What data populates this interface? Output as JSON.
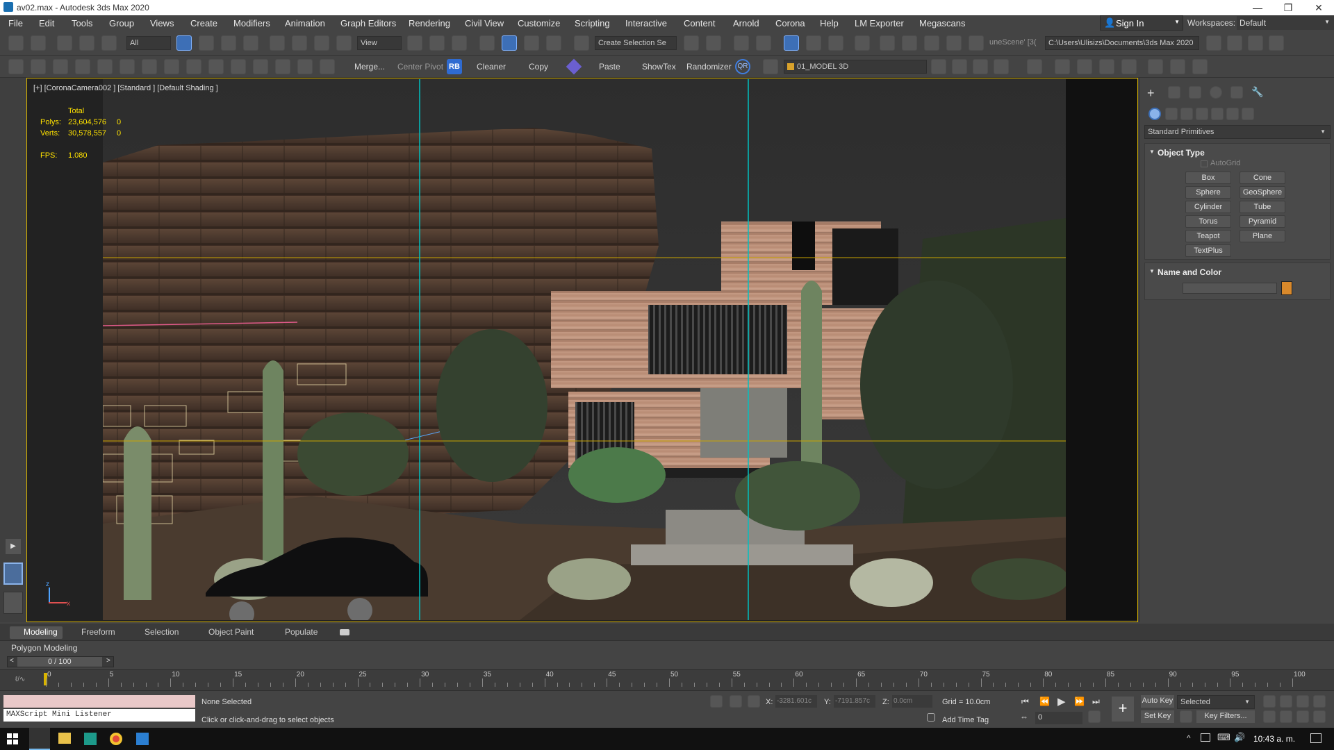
{
  "window": {
    "title": "av02.max - Autodesk 3ds Max 2020",
    "min": "—",
    "restore": "❐",
    "close": "✕"
  },
  "menu": [
    "File",
    "Edit",
    "Tools",
    "Group",
    "Views",
    "Create",
    "Modifiers",
    "Animation",
    "Graph Editors",
    "Rendering",
    "Civil View",
    "Customize",
    "Scripting",
    "Interactive",
    "Content",
    "Arnold",
    "Corona",
    "Help",
    "LM Exporter",
    "Megascans"
  ],
  "account": {
    "sign_in": "Sign In",
    "workspaces_label": "Workspaces:",
    "workspace": "Default"
  },
  "toolbar1": {
    "filter": "All",
    "ref_coord": "View",
    "selection_set": "Create Selection Se",
    "scene_name": "uneScene' [3(",
    "project_path": "C:\\Users\\Ulisizs\\Documents\\3ds Max 2020"
  },
  "toolbar2": {
    "merge": "Merge...",
    "center_pivot": "Center Pivot",
    "rb": "RB",
    "cleaner": "Cleaner",
    "copy": "Copy",
    "paste": "Paste",
    "showtex": "ShowTex",
    "randomizer": "Randomizer",
    "qr": "QR",
    "layer": "01_MODEL 3D"
  },
  "viewport": {
    "label": "[+] [CoronaCamera002 ] [Standard ] [Default Shading ]",
    "stats": {
      "header": "Total",
      "polys_label": "Polys:",
      "polys": "23,604,576",
      "polys_sel": "0",
      "verts_label": "Verts:",
      "verts": "30,578,557",
      "verts_sel": "0",
      "fps_label": "FPS:",
      "fps": "1.080"
    },
    "axis_z": "z",
    "axis_x": "x"
  },
  "command_panel": {
    "category": "Standard Primitives",
    "object_type_title": "Object Type",
    "autogrid": "AutoGrid",
    "buttons": [
      "Box",
      "Cone",
      "Sphere",
      "GeoSphere",
      "Cylinder",
      "Tube",
      "Torus",
      "Pyramid",
      "Teapot",
      "Plane",
      "TextPlus"
    ],
    "name_color_title": "Name and Color",
    "swatch_color": "#d9892b"
  },
  "ribbon_tabs": [
    "Modeling",
    "Freeform",
    "Selection",
    "Object Paint",
    "Populate"
  ],
  "ribbon_sub": "Polygon Modeling",
  "time": {
    "frame": "0 / 100",
    "ticks": [
      "0",
      "5",
      "10",
      "15",
      "20",
      "25",
      "30",
      "35",
      "40",
      "45",
      "50",
      "55",
      "60",
      "65",
      "70",
      "75",
      "80",
      "85",
      "90",
      "95",
      "100"
    ]
  },
  "status": {
    "maxscript": "MAXScript Mini Listener",
    "selected": "None Selected",
    "prompt": "Click or click-and-drag to select objects",
    "x_label": "X:",
    "x": "-3281.601c",
    "y_label": "Y:",
    "y": "-7191.857c",
    "z_label": "Z:",
    "z": "0.0cm",
    "grid": "Grid = 10.0cm",
    "add_time_tag": "Add Time Tag",
    "auto_key": "Auto Key",
    "set_key": "Set Key",
    "key_mode": "Selected",
    "key_filters": "Key Filters...",
    "current_frame": "0"
  },
  "taskbar": {
    "time": "10:43 a. m."
  }
}
